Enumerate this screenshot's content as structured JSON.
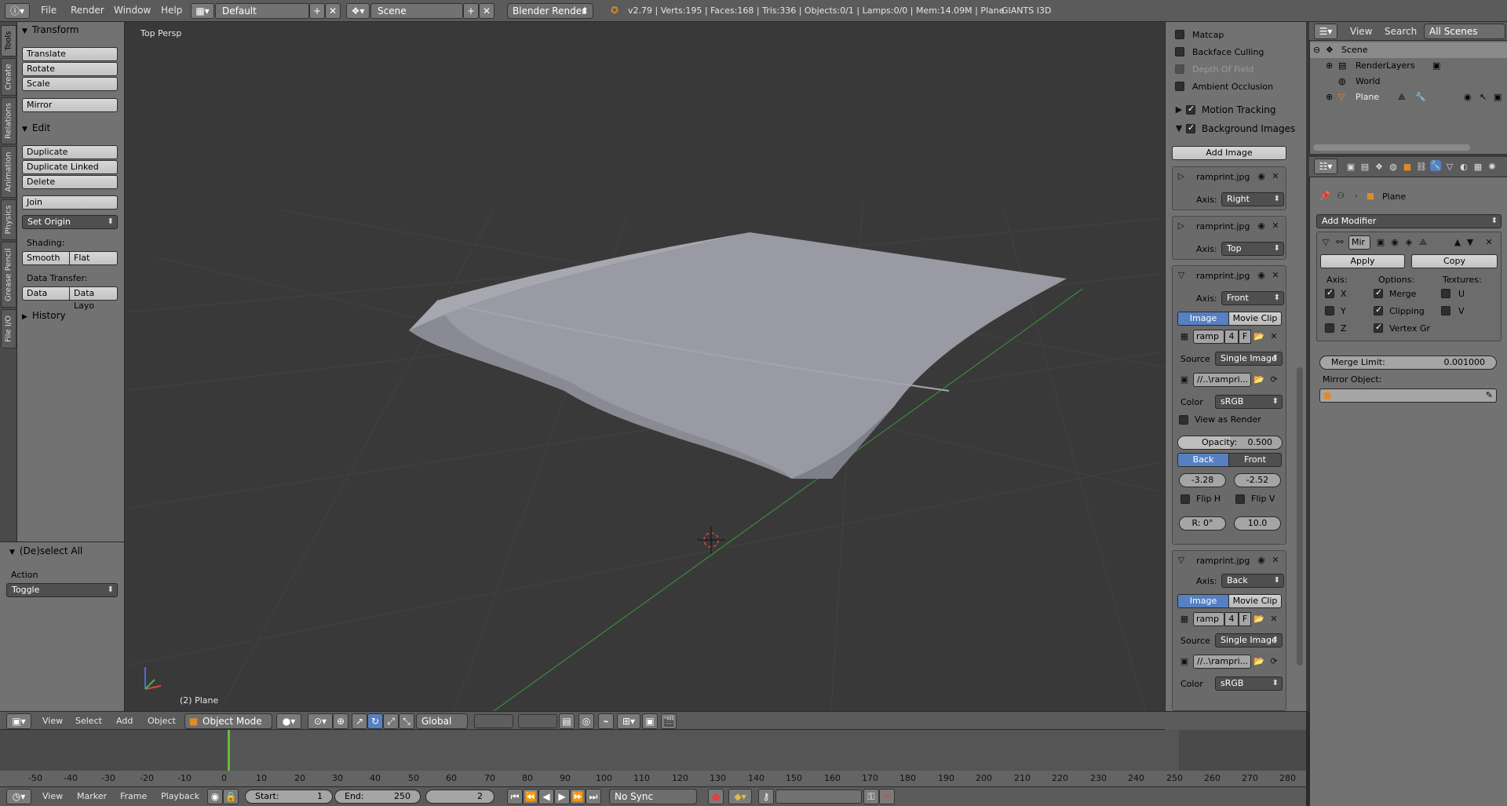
{
  "topbar": {
    "menus": [
      "File",
      "Render",
      "Window",
      "Help"
    ],
    "layout": "Default",
    "scene": "Scene",
    "engine": "Blender Render",
    "stats": "v2.79 | Verts:195 | Faces:168 | Tris:336 | Objects:0/1 | Lamps:0/0 | Mem:14.09M | Plane",
    "extra": "GIANTS I3D"
  },
  "tabs": [
    "Tools",
    "Create",
    "Relations",
    "Animation",
    "Physics",
    "Grease Pencil",
    "File I/O"
  ],
  "toolshelf": {
    "transform_title": "Transform",
    "translate": "Translate",
    "rotate": "Rotate",
    "scale": "Scale",
    "mirror": "Mirror",
    "edit_title": "Edit",
    "duplicate": "Duplicate",
    "duplicate_linked": "Duplicate Linked",
    "delete": "Delete",
    "join": "Join",
    "set_origin": "Set Origin",
    "shading_label": "Shading:",
    "smooth": "Smooth",
    "flat": "Flat",
    "data_transfer_label": "Data Transfer:",
    "data": "Data",
    "data_layout": "Data Layo",
    "history_title": "History"
  },
  "operator": {
    "title": "(De)select All",
    "action_label": "Action",
    "action_value": "Toggle"
  },
  "viewport": {
    "view_name": "Top Persp",
    "object_label": "(2) Plane"
  },
  "npanel": {
    "matcap": "Matcap",
    "backface": "Backface Culling",
    "dof": "Depth Of Field",
    "ao": "Ambient Occlusion",
    "motion_tracking": "Motion Tracking",
    "background_images": "Background Images",
    "add_image": "Add Image",
    "axis_label": "Axis:",
    "images": [
      {
        "name": "ramprint.jpg",
        "axis": "Right"
      },
      {
        "name": "ramprint.jpg",
        "axis": "Top"
      },
      {
        "name": "ramprint.jpg",
        "axis": "Front"
      },
      {
        "name": "ramprint.jpg",
        "axis": "Back"
      }
    ],
    "image_tab": "Image",
    "movie_clip_tab": "Movie Clip",
    "img_field": "ramp",
    "img_users": "4",
    "img_fake": "F",
    "source_label": "Source",
    "source_value": "Single Image",
    "filepath": "//..\\rampri...",
    "color_label": "Color",
    "color_value": "sRGB",
    "view_as_render": "View as Render",
    "opacity_label": "Opacity:",
    "opacity_value": "0.500",
    "back": "Back",
    "front": "Front",
    "offset_x": "-3.28",
    "offset_y": "-2.52",
    "flip_h": "Flip H",
    "flip_v": "Flip V",
    "rotation": "R: 0°",
    "size": "10.0"
  },
  "outliner": {
    "view": "View",
    "search": "Search",
    "all_scenes": "All Scenes",
    "items": [
      "Scene",
      "RenderLayers",
      "World",
      "Plane"
    ]
  },
  "properties": {
    "object_name": "Plane",
    "add_modifier": "Add Modifier",
    "mod_name": "Mir",
    "apply": "Apply",
    "copy": "Copy",
    "axis_label": "Axis:",
    "options_label": "Options:",
    "textures_label": "Textures:",
    "x": "X",
    "y": "Y",
    "z": "Z",
    "merge": "Merge",
    "clipping": "Clipping",
    "vertex_gr": "Vertex Gr",
    "u": "U",
    "v": "V",
    "merge_limit_label": "Merge Limit:",
    "merge_limit_value": "0.001000",
    "mirror_object_label": "Mirror Object:"
  },
  "header3d": {
    "view": "View",
    "select": "Select",
    "add": "Add",
    "object": "Object",
    "mode": "Object Mode",
    "orientation": "Global"
  },
  "timeline": {
    "ticks": [
      "-50",
      "-40",
      "-30",
      "-20",
      "-10",
      "0",
      "10",
      "20",
      "30",
      "40",
      "50",
      "60",
      "70",
      "80",
      "90",
      "100",
      "110",
      "120",
      "130",
      "140",
      "150",
      "160",
      "170",
      "180",
      "190",
      "200",
      "210",
      "220",
      "230",
      "240",
      "250",
      "260",
      "270",
      "280"
    ],
    "view": "View",
    "marker": "Marker",
    "frame": "Frame",
    "playback": "Playback",
    "start_label": "Start:",
    "start_value": "1",
    "end_label": "End:",
    "end_value": "250",
    "current": "2",
    "sync": "No Sync"
  },
  "colors": {
    "accent": "#5680c2",
    "grid_x": "#ad3d3d",
    "grid_y": "#3c8a3c",
    "frame_cursor": "#60c040"
  }
}
